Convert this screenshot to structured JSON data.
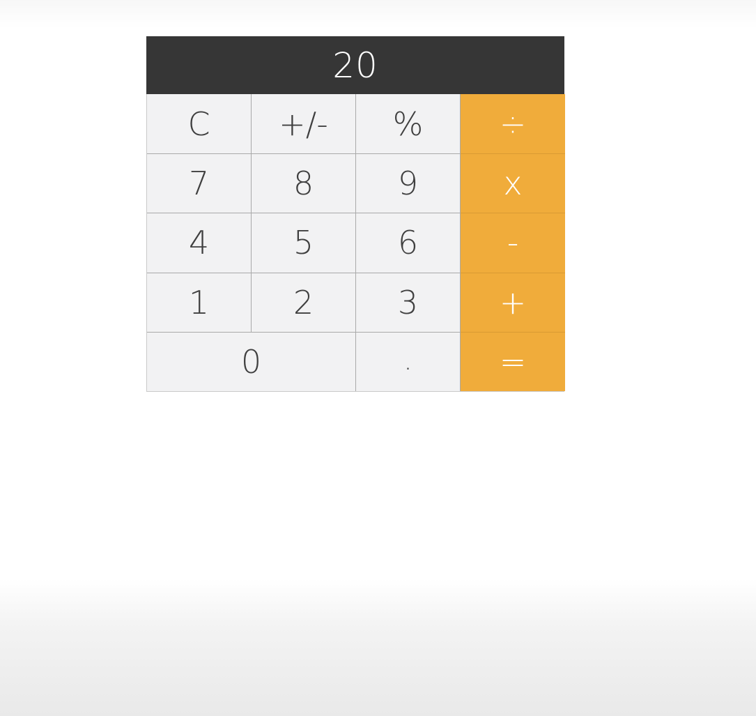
{
  "calculator": {
    "display_value": "20",
    "keys": {
      "clear": "C",
      "negate": "+/-",
      "percent": "%",
      "divide": "÷",
      "seven": "7",
      "eight": "8",
      "nine": "9",
      "multiply": "x",
      "four": "4",
      "five": "5",
      "six": "6",
      "subtract": "-",
      "one": "1",
      "two": "2",
      "three": "3",
      "add": "+",
      "zero": "0",
      "decimal": ".",
      "equals": "="
    },
    "colors": {
      "display_background": "#363636",
      "display_text": "#ffffff",
      "key_background": "#f2f2f3",
      "key_text": "#3f3f3f",
      "operator_background": "#f0ac3b",
      "operator_text": "#ffffff"
    }
  }
}
